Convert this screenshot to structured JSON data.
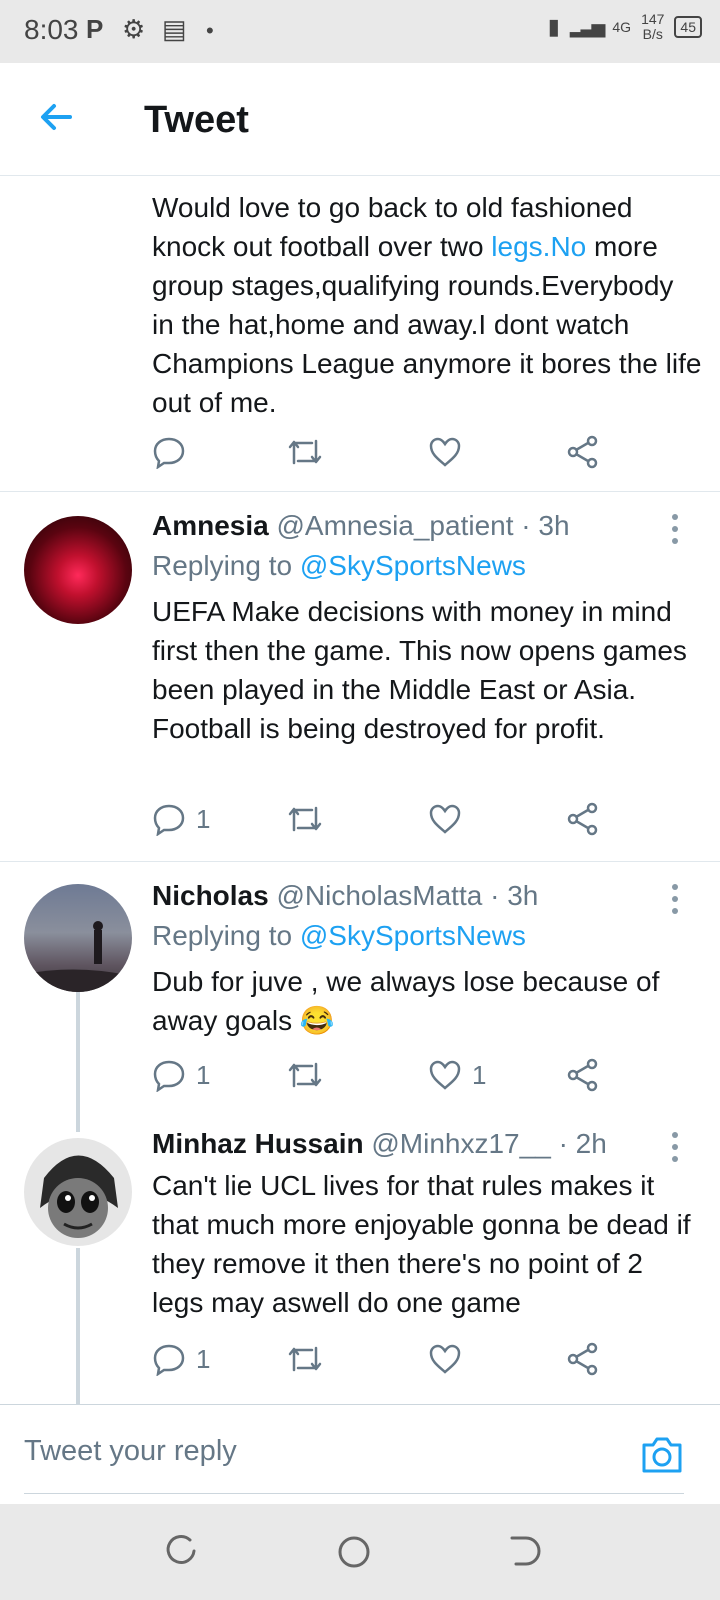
{
  "status": {
    "time": "8:03",
    "network_type": "4G",
    "speed_value": "147",
    "speed_unit": "B/s",
    "battery": "45"
  },
  "appbar": {
    "title": "Tweet"
  },
  "tweets": [
    {
      "text_parts": [
        "Would love to go back to old fashioned knock out football over two ",
        "legs.No",
        " more group stages,qualifying rounds.Everybody in the hat,home and away.I dont watch Champions League anymore it bores the life out of me."
      ],
      "counts": {
        "reply": "",
        "retweet": "",
        "like": ""
      }
    },
    {
      "name": "Amnesia",
      "handle": "@Amnesia_patient",
      "time": "· 3h",
      "replying_prefix": "Replying to",
      "replying_to": "@SkySportsNews",
      "text": "UEFA Make decisions with money in mind first then the game. This now opens games been played in the Middle East or Asia. Football is being destroyed for profit.",
      "counts": {
        "reply": "1",
        "retweet": "",
        "like": ""
      }
    },
    {
      "name": "Nicholas",
      "handle": "@NicholasMatta",
      "time": "· 3h",
      "replying_prefix": "Replying to",
      "replying_to": "@SkySportsNews",
      "text": "Dub for juve , we always lose because of away goals",
      "emoji": "😂",
      "counts": {
        "reply": "1",
        "retweet": "",
        "like": "1"
      }
    },
    {
      "name": "Minhaz Hussain",
      "handle": "@Minhxz17__",
      "time": "· 2h",
      "text": "Can't lie UCL lives for that rules makes it that much more enjoyable gonna be dead if they remove it then there's no point of 2 legs may aswell do one game",
      "counts": {
        "reply": "1",
        "retweet": "",
        "like": ""
      }
    }
  ],
  "reply_bar": {
    "placeholder": "Tweet your reply"
  },
  "colors": {
    "accent": "#1da1f2",
    "secondary_text": "#657786",
    "divider": "#e1e8ed"
  },
  "icons": [
    "back-arrow-icon",
    "reply-icon",
    "retweet-icon",
    "like-icon",
    "share-icon",
    "more-icon",
    "camera-icon"
  ]
}
